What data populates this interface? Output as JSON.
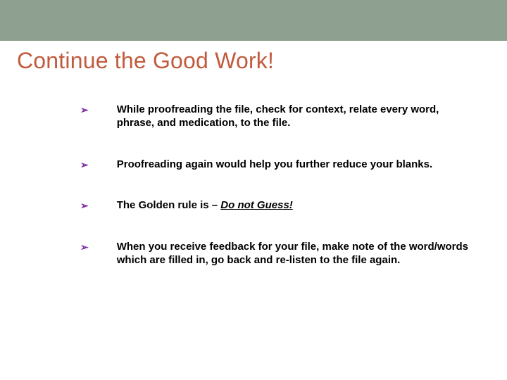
{
  "title": "Continue the Good Work!",
  "marker": "➢",
  "bullets": {
    "b0": "While proofreading the file, check for context, relate every word, phrase, and medication, to the file.",
    "b1": "Proofreading again would help you further reduce your blanks.",
    "b2_prefix": "The Golden rule is – ",
    "b2_em": "Do not Guess!",
    "b3": "When you receive feedback for your file, make note of the word/words which are filled in, go back and re-listen to the file again."
  }
}
